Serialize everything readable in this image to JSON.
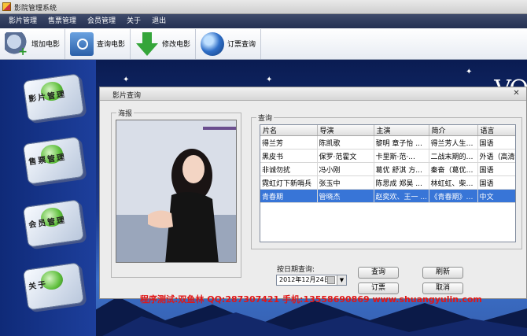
{
  "window": {
    "title": "影院管理系统"
  },
  "menu": [
    "影片管理",
    "售票管理",
    "会员管理",
    "关于",
    "退出"
  ],
  "toolbar": {
    "add_movie": "增加电影",
    "query_movie": "查询电影",
    "edit_movie": "修改电影",
    "query_ticket": "订票查询"
  },
  "sidebar": [
    {
      "label": "影片管理",
      "icon": "film-icon"
    },
    {
      "label": "售票管理",
      "icon": "ticket-icon"
    },
    {
      "label": "会员管理",
      "icon": "member-icon"
    },
    {
      "label": "关于",
      "icon": "about-icon"
    }
  ],
  "dialog": {
    "title": "影片查询",
    "poster_label": "海报",
    "query_label": "查询",
    "columns": [
      "片名",
      "导演",
      "主演",
      "简介",
      "语言"
    ],
    "rows": [
      [
        "得兰芳",
        "陈凯歌",
        "黎明 章子怡 ...",
        "得兰芳人生的...",
        "国语"
      ],
      [
        "黑皮书",
        "保罗·范霍文",
        "卡里斯·范·...",
        "二战末期的荷...",
        "外语（高清"
      ],
      [
        "非诚勿扰",
        "冯小刚",
        "葛优 舒淇 方...",
        "秦奋（葛优饰...",
        "国语"
      ],
      [
        "霓虹灯下新哨兵",
        "张玉中",
        "陈思成 郑昊 ...",
        "林虹虹、柴大...",
        "国语"
      ],
      [
        "青春期",
        "管晓杰",
        "赵奕欢、王一 ...",
        "《青春期》是...",
        "中文"
      ]
    ],
    "selected_row": 4,
    "date_label": "按日期查询:",
    "date_value": "2012年12月24日",
    "buttons": {
      "query": "查询",
      "refresh": "刷新",
      "book": "订票",
      "cancel": "取消"
    }
  },
  "footer": "程序测试:双鱼林 QQ:287307421 手机:13558690869 www.shuangyulin.com",
  "colors": {
    "accent": "#3875d7",
    "footer_text": "#e01818",
    "menubar": "#2e3a5c"
  }
}
